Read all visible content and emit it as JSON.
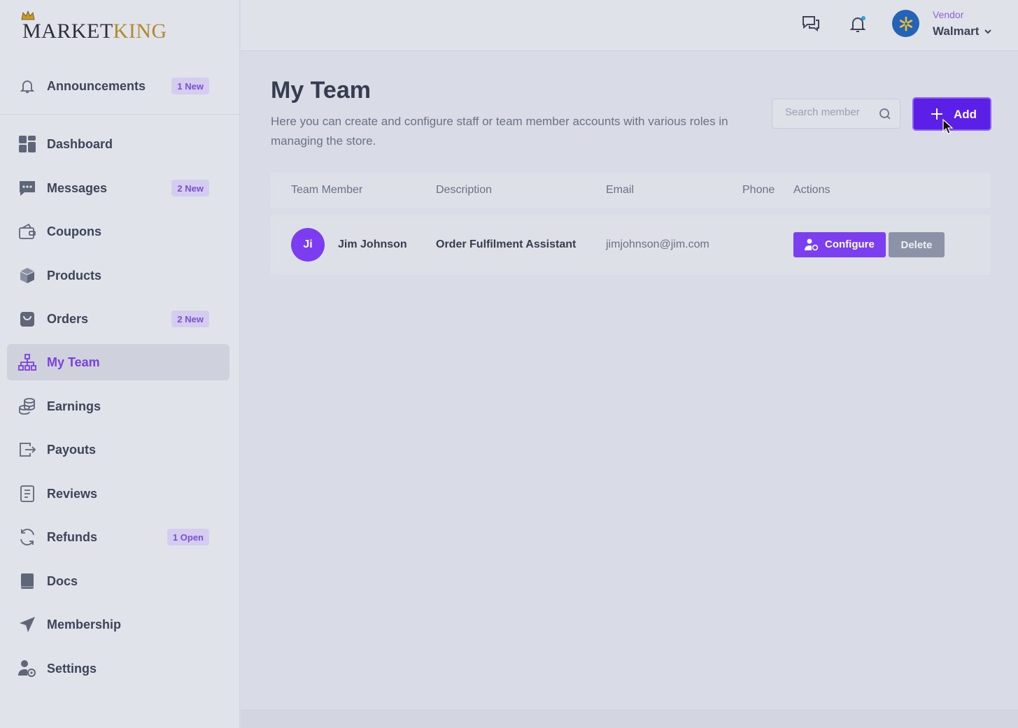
{
  "logo": {
    "text_before": "MARKET",
    "text_k": "KING"
  },
  "sidebar": {
    "items": [
      {
        "key": "announcements",
        "label": "Announcements",
        "badge": "1 New",
        "icon": "bell-icon"
      },
      {
        "key": "dashboard",
        "label": "Dashboard",
        "badge": "",
        "icon": "grid-icon"
      },
      {
        "key": "messages",
        "label": "Messages",
        "badge": "2 New",
        "icon": "chat-icon"
      },
      {
        "key": "coupons",
        "label": "Coupons",
        "badge": "",
        "icon": "wallet-icon"
      },
      {
        "key": "products",
        "label": "Products",
        "badge": "",
        "icon": "box-icon"
      },
      {
        "key": "orders",
        "label": "Orders",
        "badge": "2 New",
        "icon": "bag-icon"
      },
      {
        "key": "my-team",
        "label": "My Team",
        "badge": "",
        "icon": "org-chart-icon",
        "active": true
      },
      {
        "key": "earnings",
        "label": "Earnings",
        "badge": "",
        "icon": "coins-icon"
      },
      {
        "key": "payouts",
        "label": "Payouts",
        "badge": "",
        "icon": "export-icon"
      },
      {
        "key": "reviews",
        "label": "Reviews",
        "badge": "",
        "icon": "clipboard-icon"
      },
      {
        "key": "refunds",
        "label": "Refunds",
        "badge": "1 Open",
        "icon": "refresh-icon"
      },
      {
        "key": "docs",
        "label": "Docs",
        "badge": "",
        "icon": "book-icon"
      },
      {
        "key": "membership",
        "label": "Membership",
        "badge": "",
        "icon": "send-icon"
      },
      {
        "key": "settings",
        "label": "Settings",
        "badge": "",
        "icon": "user-gear-icon"
      }
    ]
  },
  "header": {
    "vendor_role": "Vendor",
    "vendor_name": "Walmart"
  },
  "main": {
    "title": "My Team",
    "description": "Here you can create and configure staff or team member accounts with various roles in managing the store.",
    "search_placeholder": "Search member",
    "add_label": "Add"
  },
  "table": {
    "headers": {
      "member": "Team Member",
      "description": "Description",
      "email": "Email",
      "phone": "Phone",
      "actions": "Actions"
    },
    "rows": [
      {
        "initials": "Ji",
        "name": "Jim Johnson",
        "description": "Order Fulfilment Assistant",
        "email": "jimjohnson@jim.com",
        "phone": "",
        "configure_label": "Configure",
        "delete_label": "Delete"
      }
    ]
  },
  "colors": {
    "accent": "#7b3ff0",
    "add_button": "#5b1fe8",
    "delete_button": "#8c93a6",
    "badge_bg": "#d5cdf0"
  }
}
